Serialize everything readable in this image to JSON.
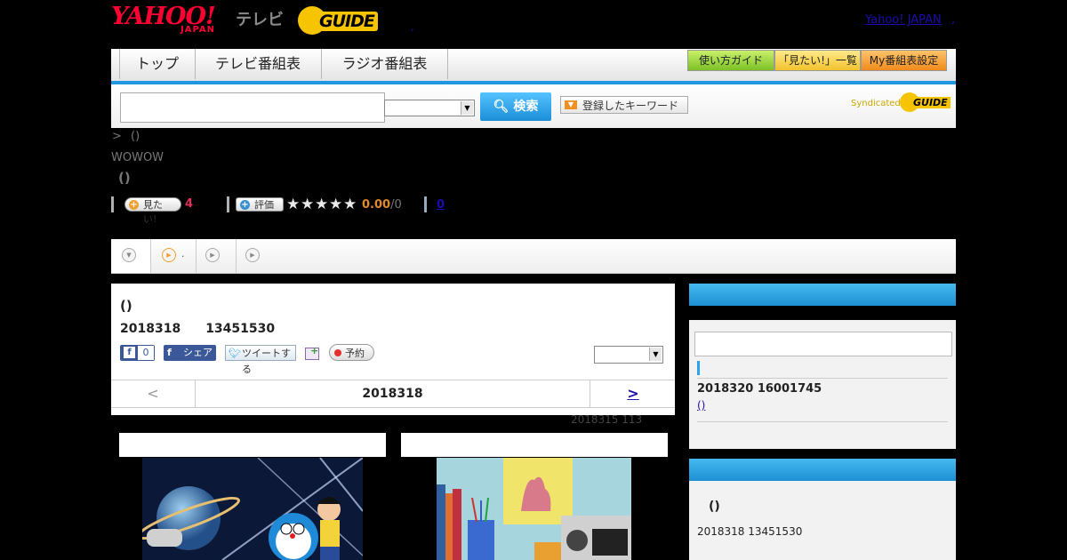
{
  "header": {
    "yahoo_logo": "YAHOO!",
    "yahoo_logo_sub": "JAPAN",
    "tv_label": "テレビ",
    "gguide_logo": "GUIDE",
    "yahoo_link": "Yahoo! JAPAN",
    "yahoo_link_trail": ",",
    "dot_mark": ","
  },
  "nav": {
    "tabs": [
      "トップ",
      "テレビ番組表",
      "ラジオ番組表"
    ],
    "guide_buttons": [
      "使い方ガイド",
      "「見たい!」一覧",
      "My番組表設定"
    ]
  },
  "search": {
    "input_value": "",
    "button_label": "検索",
    "keyword_button": "登録したキーワード",
    "syndicated_label": "Syndicated",
    "syndicated_logo": "GUIDE"
  },
  "breadcrumb": {
    "arrow": ">",
    "text": "()"
  },
  "channel": "WOWOW",
  "program_title": "()",
  "actions": {
    "mitai_label": "見たい!",
    "mitai_count": "4",
    "hyouka_label": "評価",
    "rating": "0.00",
    "rating_count": "/0",
    "comment_count": "0"
  },
  "tabs_bar": {
    "tab2_dot": "."
  },
  "main": {
    "title": "()",
    "date_time": "2018318　　13451530",
    "like_count": "0",
    "share_label": "シェア",
    "tweet_label": "ツイートする",
    "reserve_label": "予約",
    "date_nav": {
      "prev": "<",
      "current": "2018318",
      "next": ">"
    },
    "updated_text": "2018315  113"
  },
  "sidebar": {
    "box1": {
      "date_time": "2018320  16001745",
      "link": "()"
    },
    "box2": {
      "title": "()",
      "date_time": "2018318  13451530"
    }
  },
  "colors": {
    "accent_blue": "#1d90d3",
    "yahoo_red": "#ff0033",
    "gguide_yellow": "#f6c400",
    "link_blue": "#1a0dab",
    "pink_count": "#e0305a",
    "orange_rating": "#e08a2a"
  }
}
